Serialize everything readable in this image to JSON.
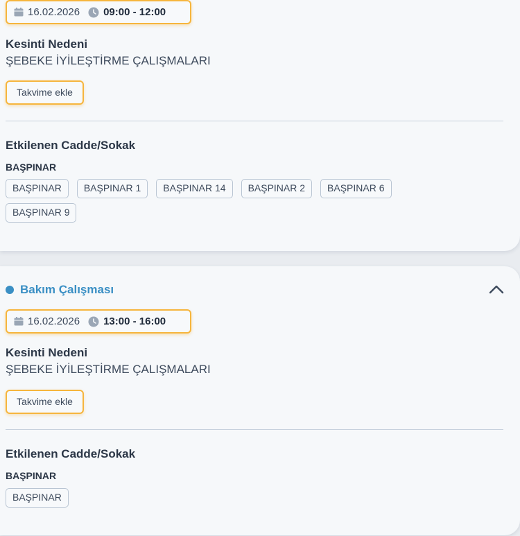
{
  "outages": [
    {
      "date": "16.02.2026",
      "time": "09:00 - 12:00",
      "reason_label": "Kesinti Nedeni",
      "reason": "ŞEBEKE İYİLEŞTİRME ÇALIŞMALARI",
      "add_calendar_label": "Takvime ekle",
      "affected_label": "Etkilenen Cadde/Sokak",
      "district": "BAŞPINAR",
      "streets": [
        "BAŞPINAR",
        "BAŞPINAR 1",
        "BAŞPINAR 14",
        "BAŞPINAR 2",
        "BAŞPINAR 6",
        "BAŞPINAR 9"
      ]
    },
    {
      "status": "Bakım Çalışması",
      "date": "16.02.2026",
      "time": "13:00 - 16:00",
      "reason_label": "Kesinti Nedeni",
      "reason": "ŞEBEKE İYİLEŞTİRME ÇALIŞMALARI",
      "add_calendar_label": "Takvime ekle",
      "affected_label": "Etkilenen Cadde/Sokak",
      "district": "BAŞPINAR",
      "streets": [
        "BAŞPINAR"
      ]
    }
  ],
  "icons": {
    "calendar": "calendar-icon",
    "clock": "clock-icon",
    "collapse": "chevron-up-icon"
  },
  "colors": {
    "accent_orange": "#f6b53d",
    "status_blue": "#3a8fc4",
    "tag_border": "#b9c5d3"
  }
}
